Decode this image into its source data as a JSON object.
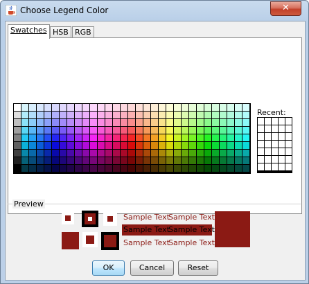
{
  "window": {
    "title": "Choose Legend Color",
    "close_label": "✕",
    "app_icon": "java-cup-icon"
  },
  "tabs": [
    {
      "label": "Swatches",
      "active": true
    },
    {
      "label": "HSB",
      "active": false
    },
    {
      "label": "RGB",
      "active": false
    }
  ],
  "recent": {
    "label": "Recent:"
  },
  "preview": {
    "label": "Preview",
    "color": "#8b1a14",
    "sample_text": "Sample Text"
  },
  "buttons": {
    "ok": "OK",
    "cancel": "Cancel",
    "reset": "Reset"
  }
}
